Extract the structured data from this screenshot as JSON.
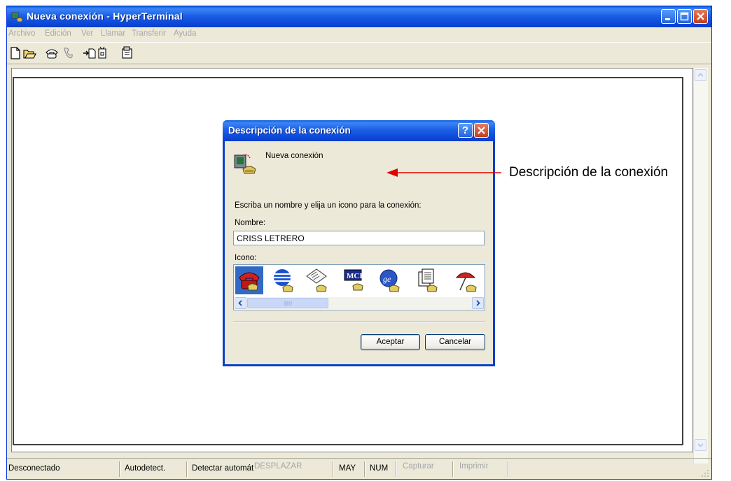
{
  "window": {
    "title": "Nueva conexión - HyperTerminal"
  },
  "menu": [
    "Archivo",
    "Edición",
    "Ver",
    "Llamar",
    "Transferir",
    "Ayuda"
  ],
  "toolbar": {
    "buttons": [
      "new-icon",
      "open-icon",
      "connect-icon",
      "disconnect-icon",
      "send-icon",
      "receive-icon",
      "properties-icon"
    ]
  },
  "statusbar": {
    "status": "Desconectado",
    "autodetect": "Autodetect.",
    "detect": "Detectar automát",
    "scroll": "DESPLAZAR",
    "caps": "MAY",
    "num": "NUM",
    "capture": "Capturar",
    "print": "Imprimir"
  },
  "dialog": {
    "title": "Descripción de la conexión",
    "help_label": "?",
    "header_text": "Nueva conexión",
    "instructions": "Escriba un nombre y elija un icono para la conexión:",
    "name_label": "Nombre:",
    "name_value": "CRISS LETRERO",
    "icon_label": "Icono:",
    "icons": [
      "phone-red-icon",
      "globe-icon",
      "newspaper-icon",
      "mci-icon",
      "ge-icon",
      "documents-icon",
      "umbrella-icon"
    ],
    "selected_icon_index": 0,
    "ok_label": "Aceptar",
    "cancel_label": "Cancelar"
  },
  "annotation": {
    "text": "Descripción de la conexión",
    "color": "#e00000"
  }
}
